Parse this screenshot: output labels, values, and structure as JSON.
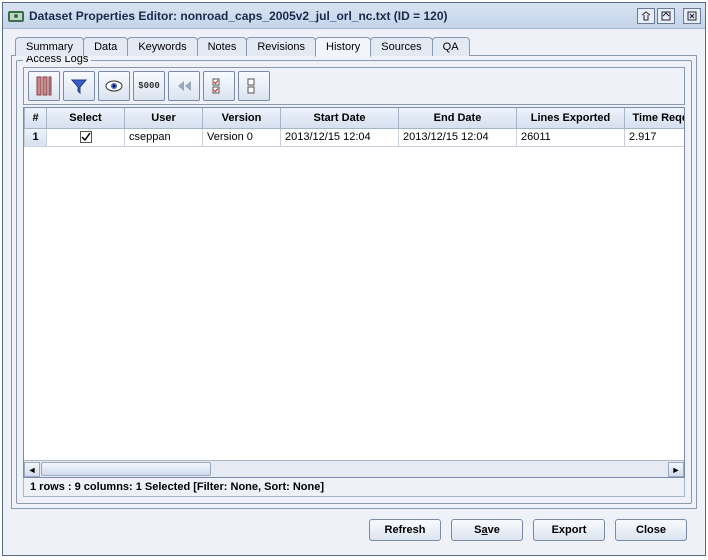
{
  "window": {
    "title": "Dataset Properties Editor: nonroad_caps_2005v2_jul_orl_nc.txt (ID = 120)"
  },
  "tabs": [
    "Summary",
    "Data",
    "Keywords",
    "Notes",
    "Revisions",
    "History",
    "Sources",
    "QA"
  ],
  "active_tab": "History",
  "fieldset_label": "Access Logs",
  "toolbar_icons": [
    "columns-icon",
    "filter-icon",
    "eye-icon",
    "format-icon",
    "first-icon",
    "checklist-icon",
    "unchecklist-icon"
  ],
  "columns": [
    "#",
    "Select",
    "User",
    "Version",
    "Start Date",
    "End Date",
    "Lines Exported",
    "Time Reqd. (s"
  ],
  "rows": [
    {
      "num": "1",
      "select": true,
      "user": "cseppan",
      "version": "Version 0",
      "start_date": "2013/12/15 12:04",
      "end_date": "2013/12/15 12:04",
      "lines_exported": "26011",
      "time_reqd": "2.917"
    }
  ],
  "status": "1 rows : 9 columns: 1 Selected [Filter: None, Sort: None]",
  "buttons": {
    "refresh": "Refresh",
    "save_pre": "S",
    "save_mn": "a",
    "save_post": "ve",
    "export": "Export",
    "close": "Close"
  }
}
